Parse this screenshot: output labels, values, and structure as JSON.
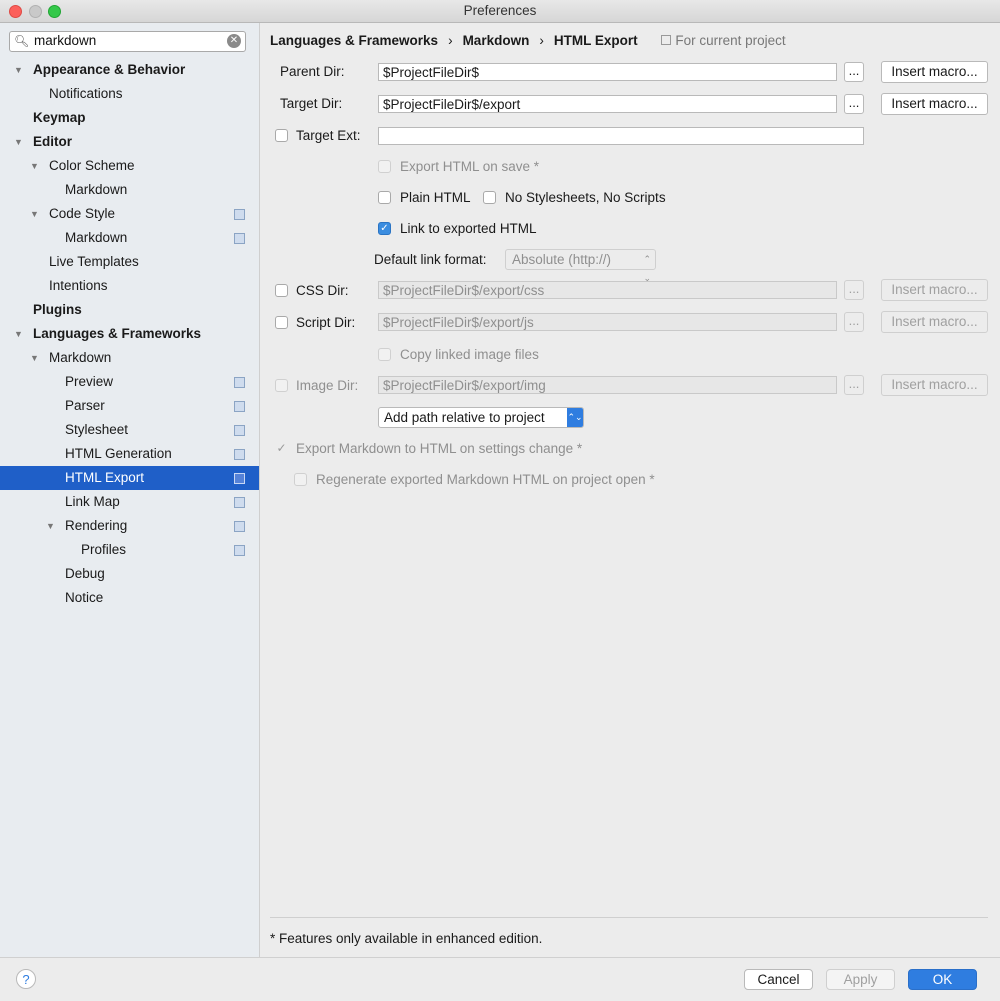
{
  "window": {
    "title": "Preferences"
  },
  "search": {
    "value": "markdown"
  },
  "sidebar": {
    "items": [
      {
        "label": "Appearance & Behavior"
      },
      {
        "label": "Notifications"
      },
      {
        "label": "Keymap"
      },
      {
        "label": "Editor"
      },
      {
        "label": "Color Scheme"
      },
      {
        "label": "Markdown"
      },
      {
        "label": "Code Style"
      },
      {
        "label": "Markdown"
      },
      {
        "label": "Live Templates"
      },
      {
        "label": "Intentions"
      },
      {
        "label": "Plugins"
      },
      {
        "label": "Languages & Frameworks"
      },
      {
        "label": "Markdown"
      },
      {
        "label": "Preview"
      },
      {
        "label": "Parser"
      },
      {
        "label": "Stylesheet"
      },
      {
        "label": "HTML Generation"
      },
      {
        "label": "HTML Export"
      },
      {
        "label": "Link Map"
      },
      {
        "label": "Rendering"
      },
      {
        "label": "Profiles"
      },
      {
        "label": "Debug"
      },
      {
        "label": "Notice"
      }
    ],
    "selected_index": 17
  },
  "breadcrumb": {
    "part1": "Languages & Frameworks",
    "sep": "›",
    "part2": "Markdown",
    "part3": "HTML Export",
    "scope": "For current project"
  },
  "form": {
    "parent_dir": {
      "label": "Parent Dir:",
      "value": "$ProjectFileDir$"
    },
    "target_dir": {
      "label": "Target Dir:",
      "value": "$ProjectFileDir$/export"
    },
    "target_ext": {
      "label": "Target Ext:",
      "value": "",
      "checked": false
    },
    "export_on_save": {
      "label": "Export HTML on save *",
      "checked": false,
      "enabled": false
    },
    "plain_html": {
      "label": "Plain HTML",
      "checked": false
    },
    "no_stylesheets": {
      "label": "No Stylesheets, No Scripts",
      "checked": false
    },
    "link_exported": {
      "label": "Link to exported HTML",
      "checked": true
    },
    "default_link_format": {
      "label": "Default link format:",
      "value": "Absolute (http://)"
    },
    "css_dir": {
      "label": "CSS Dir:",
      "value": "$ProjectFileDir$/export/css",
      "checked": false
    },
    "script_dir": {
      "label": "Script Dir:",
      "value": "$ProjectFileDir$/export/js",
      "checked": false
    },
    "copy_images": {
      "label": "Copy linked image files",
      "checked": false,
      "enabled": false
    },
    "image_dir": {
      "label": "Image Dir:",
      "value": "$ProjectFileDir$/export/img",
      "checked": false,
      "enabled": false
    },
    "path_mode": {
      "value": "Add path relative to project"
    },
    "export_on_settings_change": {
      "label": "Export Markdown to HTML on settings change *",
      "checked": true,
      "enabled": false
    },
    "regenerate_on_open": {
      "label": "Regenerate exported Markdown HTML on project open *",
      "checked": false,
      "enabled": false
    },
    "dots_label": "...",
    "insert_macro_label": "Insert macro..."
  },
  "footnote": "* Features only available in enhanced edition.",
  "buttons": {
    "help": "?",
    "cancel": "Cancel",
    "apply": "Apply",
    "ok": "OK"
  },
  "colors": {
    "selection": "#1f5fc8",
    "accent": "#2f7de0",
    "close": "#fc605b",
    "maximize": "#34c84a"
  }
}
